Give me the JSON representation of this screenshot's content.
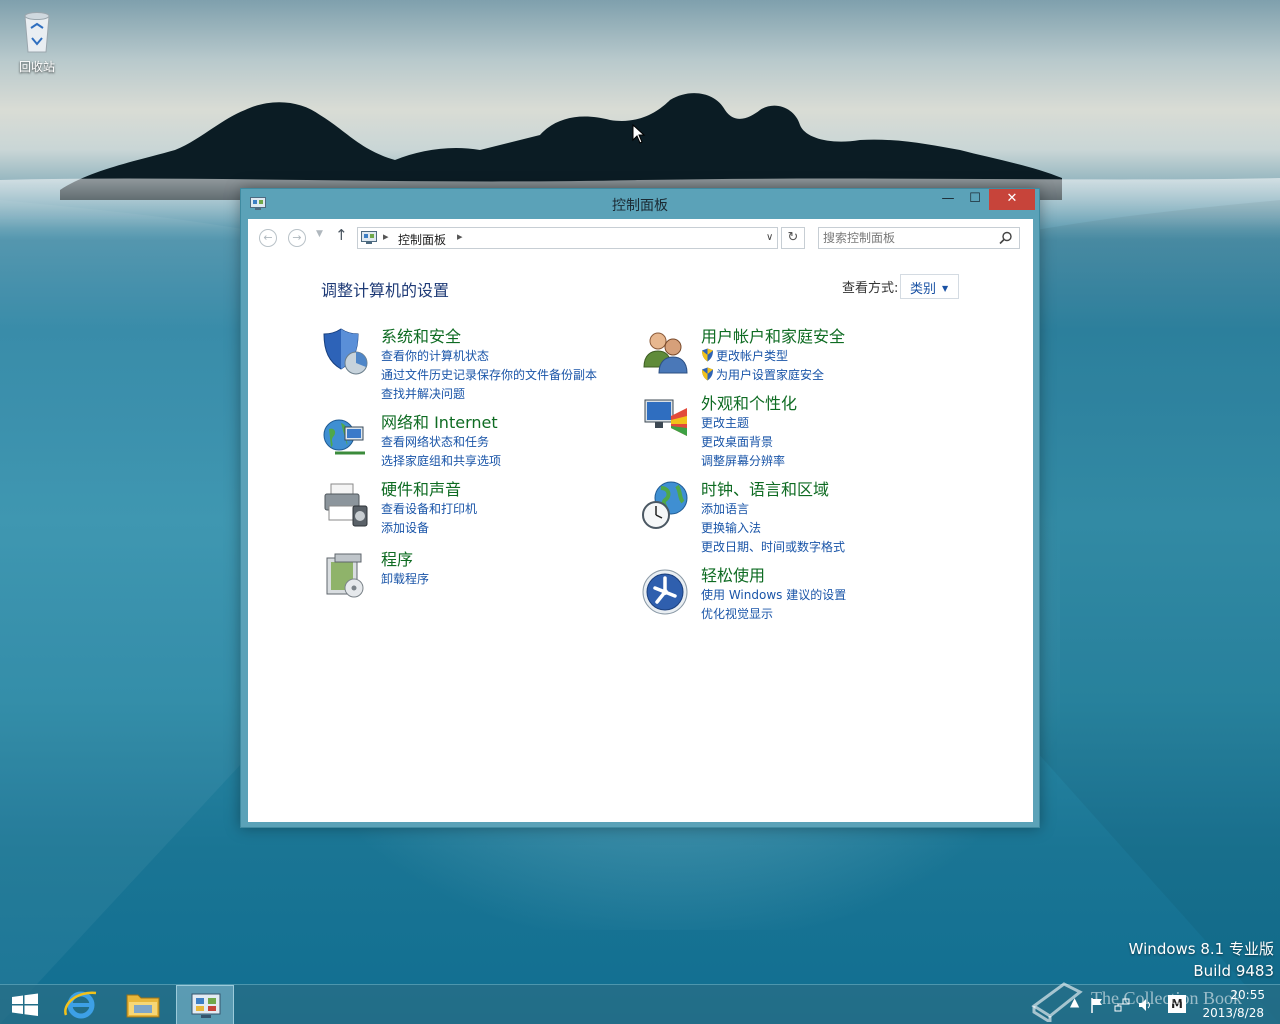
{
  "desktop": {
    "recycle_bin_label": "回收站",
    "os_version_line1": "Windows 8.1 专业版",
    "os_version_line2": "Build 9483",
    "corner_mark_text": "The Collection Book"
  },
  "window": {
    "title": "控制面板",
    "controls": {
      "minimize": "—",
      "maximize": "☐",
      "close": "✕"
    },
    "address": {
      "crumb": "控制面板"
    },
    "search": {
      "placeholder": "搜索控制面板"
    },
    "heading": "调整计算机的设置",
    "view_by": {
      "label": "查看方式:",
      "value": "类别"
    },
    "categories": [
      {
        "icon": "shield-computer-icon",
        "title": "系统和安全",
        "links": [
          {
            "text": "查看你的计算机状态"
          },
          {
            "text": "通过文件历史记录保存你的文件备份副本"
          },
          {
            "text": "查找并解决问题"
          }
        ]
      },
      {
        "icon": "network-globe-icon",
        "title": "网络和 Internet",
        "links": [
          {
            "text": "查看网络状态和任务"
          },
          {
            "text": "选择家庭组和共享选项"
          }
        ]
      },
      {
        "icon": "printer-icon",
        "title": "硬件和声音",
        "links": [
          {
            "text": "查看设备和打印机"
          },
          {
            "text": "添加设备"
          }
        ]
      },
      {
        "icon": "programs-box-icon",
        "title": "程序",
        "links": [
          {
            "text": "卸载程序"
          }
        ]
      },
      {
        "icon": "users-icon",
        "title": "用户帐户和家庭安全",
        "links": [
          {
            "text": "更改帐户类型",
            "shield": true
          },
          {
            "text": "为用户设置家庭安全",
            "shield": true
          }
        ]
      },
      {
        "icon": "appearance-monitor-icon",
        "title": "外观和个性化",
        "links": [
          {
            "text": "更改主题"
          },
          {
            "text": "更改桌面背景"
          },
          {
            "text": "调整屏幕分辨率"
          }
        ]
      },
      {
        "icon": "clock-globe-icon",
        "title": "时钟、语言和区域",
        "links": [
          {
            "text": "添加语言"
          },
          {
            "text": "更换输入法"
          },
          {
            "text": "更改日期、时间或数字格式"
          }
        ]
      },
      {
        "icon": "ease-of-access-icon",
        "title": "轻松使用",
        "links": [
          {
            "text": "使用 Windows 建议的设置"
          },
          {
            "text": "优化视觉显示"
          }
        ]
      }
    ]
  },
  "taskbar": {
    "items": [
      "start-button",
      "internet-explorer",
      "file-explorer",
      "control-panel"
    ],
    "tray": {
      "ime": "M",
      "time": "20:55",
      "date": "2013/8/28"
    }
  },
  "colors": {
    "window_frame": "#5ba2b8",
    "close_button": "#c7443a",
    "category_title": "#0e6b22",
    "link": "#1a55a8",
    "heading": "#1e3a76"
  }
}
